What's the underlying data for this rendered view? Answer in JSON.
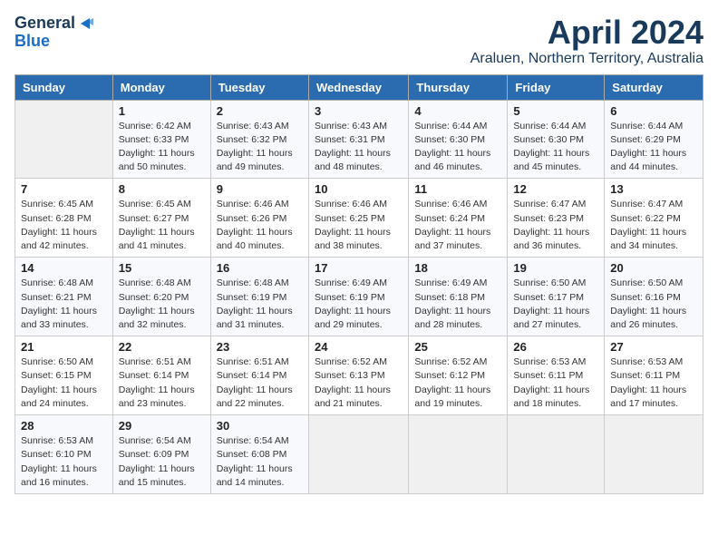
{
  "header": {
    "logo_line1": "General",
    "logo_line2": "Blue",
    "title": "April 2024",
    "subtitle": "Araluen, Northern Territory, Australia"
  },
  "weekdays": [
    "Sunday",
    "Monday",
    "Tuesday",
    "Wednesday",
    "Thursday",
    "Friday",
    "Saturday"
  ],
  "weeks": [
    [
      {
        "num": "",
        "detail": ""
      },
      {
        "num": "1",
        "detail": "Sunrise: 6:42 AM\nSunset: 6:33 PM\nDaylight: 11 hours\nand 50 minutes."
      },
      {
        "num": "2",
        "detail": "Sunrise: 6:43 AM\nSunset: 6:32 PM\nDaylight: 11 hours\nand 49 minutes."
      },
      {
        "num": "3",
        "detail": "Sunrise: 6:43 AM\nSunset: 6:31 PM\nDaylight: 11 hours\nand 48 minutes."
      },
      {
        "num": "4",
        "detail": "Sunrise: 6:44 AM\nSunset: 6:30 PM\nDaylight: 11 hours\nand 46 minutes."
      },
      {
        "num": "5",
        "detail": "Sunrise: 6:44 AM\nSunset: 6:30 PM\nDaylight: 11 hours\nand 45 minutes."
      },
      {
        "num": "6",
        "detail": "Sunrise: 6:44 AM\nSunset: 6:29 PM\nDaylight: 11 hours\nand 44 minutes."
      }
    ],
    [
      {
        "num": "7",
        "detail": "Sunrise: 6:45 AM\nSunset: 6:28 PM\nDaylight: 11 hours\nand 42 minutes."
      },
      {
        "num": "8",
        "detail": "Sunrise: 6:45 AM\nSunset: 6:27 PM\nDaylight: 11 hours\nand 41 minutes."
      },
      {
        "num": "9",
        "detail": "Sunrise: 6:46 AM\nSunset: 6:26 PM\nDaylight: 11 hours\nand 40 minutes."
      },
      {
        "num": "10",
        "detail": "Sunrise: 6:46 AM\nSunset: 6:25 PM\nDaylight: 11 hours\nand 38 minutes."
      },
      {
        "num": "11",
        "detail": "Sunrise: 6:46 AM\nSunset: 6:24 PM\nDaylight: 11 hours\nand 37 minutes."
      },
      {
        "num": "12",
        "detail": "Sunrise: 6:47 AM\nSunset: 6:23 PM\nDaylight: 11 hours\nand 36 minutes."
      },
      {
        "num": "13",
        "detail": "Sunrise: 6:47 AM\nSunset: 6:22 PM\nDaylight: 11 hours\nand 34 minutes."
      }
    ],
    [
      {
        "num": "14",
        "detail": "Sunrise: 6:48 AM\nSunset: 6:21 PM\nDaylight: 11 hours\nand 33 minutes."
      },
      {
        "num": "15",
        "detail": "Sunrise: 6:48 AM\nSunset: 6:20 PM\nDaylight: 11 hours\nand 32 minutes."
      },
      {
        "num": "16",
        "detail": "Sunrise: 6:48 AM\nSunset: 6:19 PM\nDaylight: 11 hours\nand 31 minutes."
      },
      {
        "num": "17",
        "detail": "Sunrise: 6:49 AM\nSunset: 6:19 PM\nDaylight: 11 hours\nand 29 minutes."
      },
      {
        "num": "18",
        "detail": "Sunrise: 6:49 AM\nSunset: 6:18 PM\nDaylight: 11 hours\nand 28 minutes."
      },
      {
        "num": "19",
        "detail": "Sunrise: 6:50 AM\nSunset: 6:17 PM\nDaylight: 11 hours\nand 27 minutes."
      },
      {
        "num": "20",
        "detail": "Sunrise: 6:50 AM\nSunset: 6:16 PM\nDaylight: 11 hours\nand 26 minutes."
      }
    ],
    [
      {
        "num": "21",
        "detail": "Sunrise: 6:50 AM\nSunset: 6:15 PM\nDaylight: 11 hours\nand 24 minutes."
      },
      {
        "num": "22",
        "detail": "Sunrise: 6:51 AM\nSunset: 6:14 PM\nDaylight: 11 hours\nand 23 minutes."
      },
      {
        "num": "23",
        "detail": "Sunrise: 6:51 AM\nSunset: 6:14 PM\nDaylight: 11 hours\nand 22 minutes."
      },
      {
        "num": "24",
        "detail": "Sunrise: 6:52 AM\nSunset: 6:13 PM\nDaylight: 11 hours\nand 21 minutes."
      },
      {
        "num": "25",
        "detail": "Sunrise: 6:52 AM\nSunset: 6:12 PM\nDaylight: 11 hours\nand 19 minutes."
      },
      {
        "num": "26",
        "detail": "Sunrise: 6:53 AM\nSunset: 6:11 PM\nDaylight: 11 hours\nand 18 minutes."
      },
      {
        "num": "27",
        "detail": "Sunrise: 6:53 AM\nSunset: 6:11 PM\nDaylight: 11 hours\nand 17 minutes."
      }
    ],
    [
      {
        "num": "28",
        "detail": "Sunrise: 6:53 AM\nSunset: 6:10 PM\nDaylight: 11 hours\nand 16 minutes."
      },
      {
        "num": "29",
        "detail": "Sunrise: 6:54 AM\nSunset: 6:09 PM\nDaylight: 11 hours\nand 15 minutes."
      },
      {
        "num": "30",
        "detail": "Sunrise: 6:54 AM\nSunset: 6:08 PM\nDaylight: 11 hours\nand 14 minutes."
      },
      {
        "num": "",
        "detail": ""
      },
      {
        "num": "",
        "detail": ""
      },
      {
        "num": "",
        "detail": ""
      },
      {
        "num": "",
        "detail": ""
      }
    ]
  ]
}
